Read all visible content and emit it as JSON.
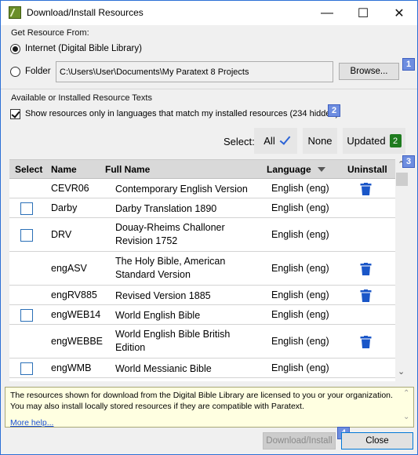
{
  "window": {
    "title": "Download/Install Resources",
    "minimize_glyph": "—",
    "maximize_glyph": "☐",
    "close_glyph": "✕"
  },
  "source": {
    "group_label": "Get Resource From:",
    "internet_label": "Internet (Digital Bible Library)",
    "internet_selected": true,
    "folder_label": "Folder",
    "folder_path": "C:\\Users\\User\\Documents\\My Paratext 8 Projects",
    "browse_label": "Browse..."
  },
  "available": {
    "group_label": "Available or Installed Resource Texts",
    "filter_label": "Show resources only in languages that match my installed resources (234 hidden)",
    "filter_checked": true
  },
  "select_bar": {
    "label": "Select:",
    "all_label": "All",
    "none_label": "None",
    "updated_label": "Updated",
    "updated_count": "2"
  },
  "grid": {
    "headers": {
      "select": "Select",
      "name": "Name",
      "full_name": "Full Name",
      "language": "Language",
      "uninstall": "Uninstall"
    },
    "rows": [
      {
        "checkbox": false,
        "name": "CEVR06",
        "full_name": "Contemporary English Version",
        "language": "English (eng)",
        "installed": true
      },
      {
        "checkbox": true,
        "name": "Darby",
        "full_name": "Darby Translation 1890",
        "language": "English (eng)",
        "installed": false
      },
      {
        "checkbox": true,
        "name": "DRV",
        "full_name": "Douay-Rheims Challoner Revision 1752",
        "language": "English (eng)",
        "installed": false
      },
      {
        "checkbox": false,
        "name": "engASV",
        "full_name": "The Holy Bible, American Standard Version",
        "language": "English (eng)",
        "installed": true
      },
      {
        "checkbox": false,
        "name": "engRV885",
        "full_name": "Revised Version 1885",
        "language": "English (eng)",
        "installed": true
      },
      {
        "checkbox": true,
        "name": "engWEB14",
        "full_name": "World English Bible",
        "language": "English (eng)",
        "installed": false
      },
      {
        "checkbox": false,
        "name": "engWEBBE",
        "full_name": "World English Bible British Edition",
        "language": "English (eng)",
        "installed": true
      },
      {
        "checkbox": true,
        "name": "engWMB",
        "full_name": "World Messianic Bible",
        "language": "English (eng)",
        "installed": false
      }
    ]
  },
  "info": {
    "line1": "The resources shown for download from the Digital Bible Library are licensed to you or your organization.",
    "line2": "You may also install locally stored resources if they are compatible with Paratext.",
    "more_help": "More help..."
  },
  "footer": {
    "download_label": "Download/Install",
    "close_label": "Close"
  },
  "badges": {
    "b1": "1",
    "b2": "2",
    "b3": "3",
    "b4": "4"
  },
  "colors": {
    "accent_check": "#2b63d6",
    "trash": "#1a56c8",
    "updated_badge": "#1e7b1e",
    "annotation_badge": "#6d8de0",
    "info_background": "#ffffe1"
  }
}
